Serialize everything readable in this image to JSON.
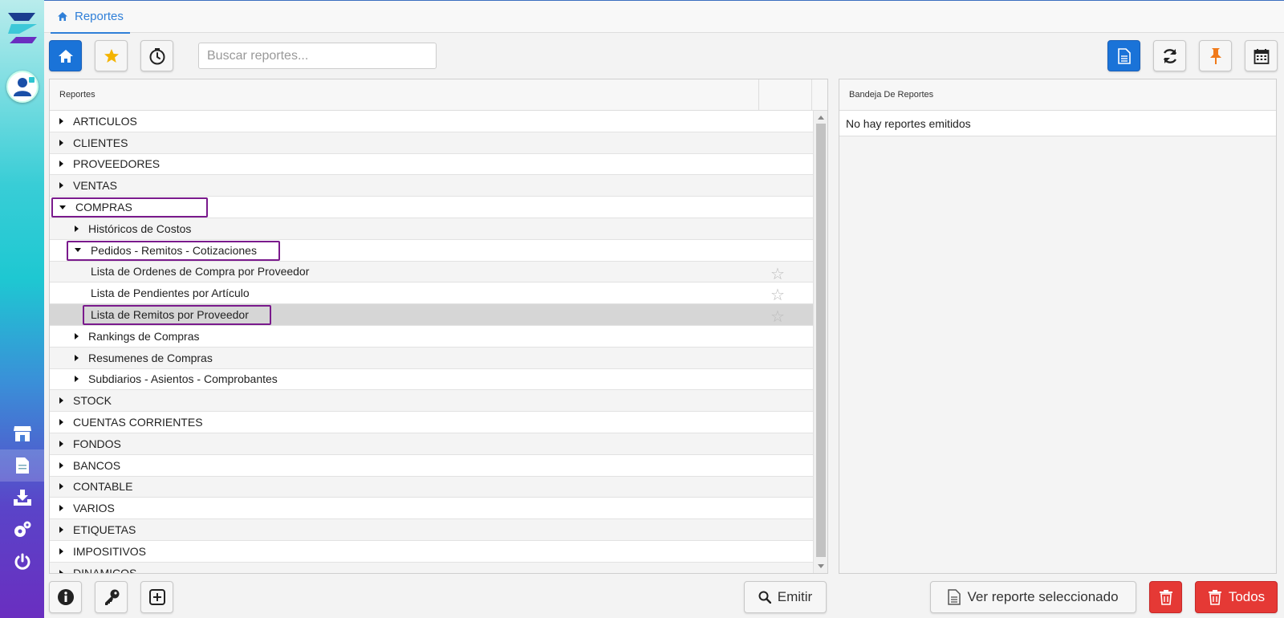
{
  "colors": {
    "accent": "#1a73d8",
    "highlight": "#7a1a8c",
    "danger": "#e53935",
    "pin": "#f07a1a",
    "fav": "#f4b400"
  },
  "tab": {
    "label": "Reportes",
    "icon": "home-icon"
  },
  "search": {
    "placeholder": "Buscar reportes..."
  },
  "left_panel": {
    "header": "Reportes",
    "rows": [
      {
        "label": "ARTICULOS",
        "level": 0,
        "caret": "right"
      },
      {
        "label": "CLIENTES",
        "level": 0,
        "caret": "right"
      },
      {
        "label": "PROVEEDORES",
        "level": 0,
        "caret": "right"
      },
      {
        "label": "VENTAS",
        "level": 0,
        "caret": "right"
      },
      {
        "label": "COMPRAS",
        "level": 0,
        "caret": "down",
        "highlight": true
      },
      {
        "label": "Históricos de Costos",
        "level": 1,
        "caret": "right"
      },
      {
        "label": "Pedidos - Remitos - Cotizaciones",
        "level": 1,
        "caret": "down",
        "highlight": true
      },
      {
        "label": "Lista de Ordenes de Compra por Proveedor",
        "level": 2,
        "star": true
      },
      {
        "label": "Lista de Pendientes por Artículo",
        "level": 2,
        "star": true
      },
      {
        "label": "Lista de Remitos por Proveedor",
        "level": 2,
        "star": true,
        "selected": true,
        "highlight": true
      },
      {
        "label": "Rankings de Compras",
        "level": 1,
        "caret": "right"
      },
      {
        "label": "Resumenes de Compras",
        "level": 1,
        "caret": "right"
      },
      {
        "label": "Subdiarios - Asientos - Comprobantes",
        "level": 1,
        "caret": "right"
      },
      {
        "label": "STOCK",
        "level": 0,
        "caret": "right"
      },
      {
        "label": "CUENTAS CORRIENTES",
        "level": 0,
        "caret": "right"
      },
      {
        "label": "FONDOS",
        "level": 0,
        "caret": "right"
      },
      {
        "label": "BANCOS",
        "level": 0,
        "caret": "right"
      },
      {
        "label": "CONTABLE",
        "level": 0,
        "caret": "right"
      },
      {
        "label": "VARIOS",
        "level": 0,
        "caret": "right"
      },
      {
        "label": "ETIQUETAS",
        "level": 0,
        "caret": "right"
      },
      {
        "label": "IMPOSITIVOS",
        "level": 0,
        "caret": "right"
      },
      {
        "label": "DINAMICOS",
        "level": 0,
        "caret": "right"
      }
    ]
  },
  "right_panel": {
    "header": "Bandeja De Reportes",
    "empty_text": "No hay reportes emitidos"
  },
  "buttons": {
    "emitir": "Emitir",
    "ver_reporte": "Ver reporte seleccionado",
    "todos": "Todos"
  }
}
